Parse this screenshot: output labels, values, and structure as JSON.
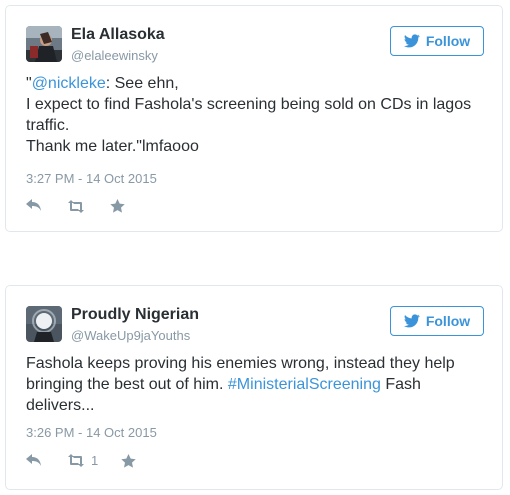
{
  "tweets": [
    {
      "name": "Ela Allasoka",
      "handle": "@elaleewinsky",
      "follow_label": "Follow",
      "text": {
        "line1_prefix": "\"",
        "line1_mention": "@nickleke",
        "line1_rest": ": See ehn,",
        "line2": "I expect to find Fashola's screening being sold on CDs in lagos",
        "line3": "traffic.",
        "line4": "Thank me later.\"lmfaooo"
      },
      "timestamp": "3:27 PM - 14 Oct 2015",
      "actions": {
        "retweet_count": ""
      },
      "icons": [
        "reply-icon",
        "retweet-icon",
        "favorite-icon"
      ]
    },
    {
      "name": "Proudly Nigerian",
      "handle": "@WakeUp9jaYouths",
      "follow_label": "Follow",
      "text": {
        "line1": "Fashola keeps proving his enemies wrong, instead they help",
        "line2_prefix": "bringing the best out of him. ",
        "line2_hashtag": "#MinisterialScreening",
        "line2_rest": " Fash",
        "line3": "delivers..."
      },
      "timestamp": "3:26 PM - 14 Oct 2015",
      "actions": {
        "retweet_count": "1"
      },
      "icons": [
        "reply-icon",
        "retweet-icon",
        "favorite-icon"
      ]
    }
  ],
  "colors": {
    "accent": "#3b94d9",
    "text": "#292f33",
    "muted": "#8899a6",
    "border": "#e1e8ed"
  }
}
